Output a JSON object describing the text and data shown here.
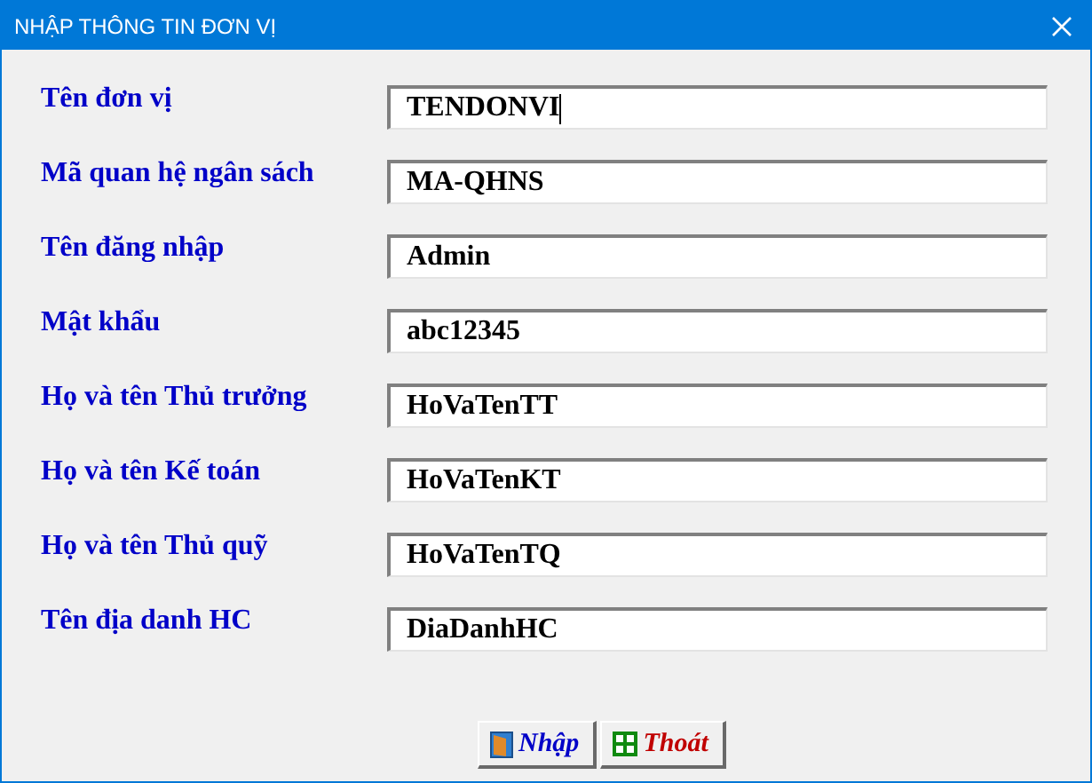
{
  "window": {
    "title": "NHẬP THÔNG TIN ĐƠN VỊ"
  },
  "fields": [
    {
      "label": "Tên đơn vị",
      "value": "TENDONVI",
      "focused": true
    },
    {
      "label": "Mã quan hệ ngân sách",
      "value": "MA-QHNS",
      "focused": false
    },
    {
      "label": "Tên đăng nhập",
      "value": "Admin",
      "focused": false
    },
    {
      "label": "Mật khẩu",
      "value": "abc12345",
      "focused": false
    },
    {
      "label": "Họ và tên Thủ trưởng",
      "value": "HoVaTenTT",
      "focused": false
    },
    {
      "label": "Họ và tên Kế toán",
      "value": "HoVaTenKT",
      "focused": false
    },
    {
      "label": "Họ và tên Thủ quỹ",
      "value": "HoVaTenTQ",
      "focused": false
    },
    {
      "label": "Tên địa danh HC",
      "value": "DiaDanhHC",
      "focused": false
    }
  ],
  "buttons": [
    {
      "label": "Nhập",
      "kind": "enter"
    },
    {
      "label": "Thoát",
      "kind": "exit"
    }
  ]
}
